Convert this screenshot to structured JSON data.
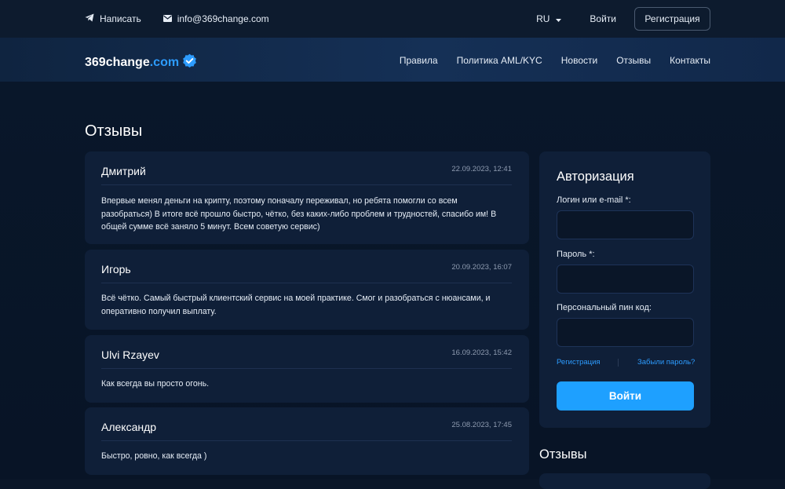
{
  "topbar": {
    "write_label": "Написать",
    "email": "info@369change.com",
    "lang": "RU",
    "login_label": "Войти",
    "register_label": "Регистрация"
  },
  "logo": {
    "main": "369change",
    "tld": ".com"
  },
  "nav": {
    "items": [
      "Правила",
      "Политика AML/KYC",
      "Новости",
      "Отзывы",
      "Контакты"
    ]
  },
  "page": {
    "title": "Отзывы"
  },
  "reviews": [
    {
      "name": "Дмитрий",
      "date": "22.09.2023, 12:41",
      "text": "Впервые менял деньги на крипту, поэтому поначалу переживал, но ребята помогли со всем разобраться) В итоге всё прошло быстро, чётко, без каких-либо проблем и трудностей, спасибо им! В общей сумме всё заняло 5 минут. Всем советую сервис)"
    },
    {
      "name": "Игорь",
      "date": "20.09.2023, 16:07",
      "text": "Всё чётко. Самый быстрый клиентский сервис на моей практике. Смог и разобраться с нюансами, и оперативно получил выплату."
    },
    {
      "name": "Ulvi Rzayev",
      "date": "16.09.2023, 15:42",
      "text": "Как всегда вы просто огонь."
    },
    {
      "name": "Александр",
      "date": "25.08.2023, 17:45",
      "text": "Быстро, ровно, как всегда )"
    }
  ],
  "auth": {
    "title": "Авторизация",
    "login_label": "Логин или e-mail *:",
    "login_value": "",
    "password_label": "Пароль *:",
    "password_value": "",
    "pin_label": "Персональный пин код:",
    "pin_value": "",
    "register_link": "Регистрация",
    "forgot_link": "Забыли пароль?",
    "submit_label": "Войти"
  },
  "sidebar": {
    "reviews_title": "Отзывы"
  },
  "colors": {
    "accent": "#1ea0ff",
    "background": "#0a1628",
    "card": "#0f1f38"
  },
  "icons": {
    "write": "telegram-icon",
    "email": "mail-icon",
    "lang": "chevron-down-icon",
    "verified": "verified-badge-icon"
  }
}
